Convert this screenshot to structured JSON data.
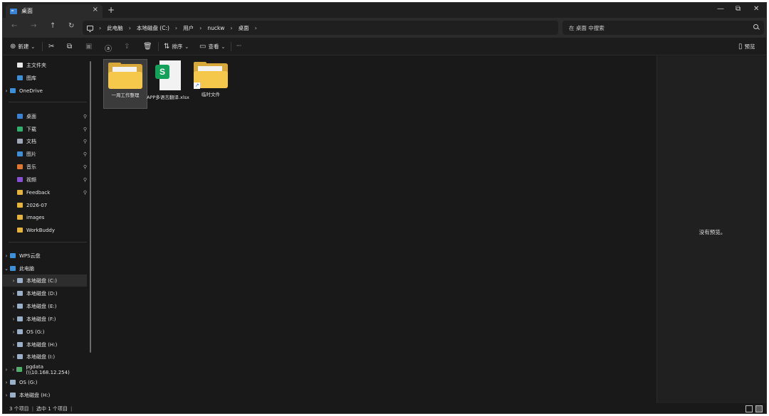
{
  "window": {
    "tab_title": "桌面",
    "tab_close": "×",
    "new_tab": "+",
    "minimize": "—",
    "maximize": "⧉",
    "close": "✕"
  },
  "nav": {
    "back": "←",
    "forward": "→",
    "up": "↑",
    "refresh": "↻",
    "breadcrumb": [
      "此电脑",
      "本地磁盘 (C:)",
      "用户",
      "nuckw",
      "桌面"
    ],
    "sep": "›",
    "search_placeholder": "在 桌面 中搜索"
  },
  "toolbar": {
    "new": "新建",
    "sort": "排序",
    "view": "查看",
    "more": "···",
    "preview": "预览"
  },
  "sidebar": {
    "items": [
      {
        "label": "主文件夹",
        "icon": "home-icon",
        "color": "#e8e8e8"
      },
      {
        "label": "图库",
        "icon": "gallery-icon",
        "color": "#3f8fd8"
      },
      {
        "label": "OneDrive",
        "icon": "cloud-icon",
        "color": "#3f8fd8"
      },
      {
        "label": "桌面",
        "icon": "desktop-icon",
        "color": "#3b82d6"
      },
      {
        "label": "下载",
        "icon": "download-icon",
        "color": "#30b06a"
      },
      {
        "label": "文档",
        "icon": "document-icon",
        "color": "#a0a8b8"
      },
      {
        "label": "图片",
        "icon": "pictures-icon",
        "color": "#3f8fd8"
      },
      {
        "label": "音乐",
        "icon": "music-icon",
        "color": "#e0782f"
      },
      {
        "label": "视频",
        "icon": "video-icon",
        "color": "#8a4fd8"
      },
      {
        "label": "Feedback",
        "icon": "folder-icon",
        "color": "#e6b43a"
      },
      {
        "label": "2026-07",
        "icon": "folder-icon",
        "color": "#e6b43a"
      },
      {
        "label": "images",
        "icon": "folder-icon",
        "color": "#e6b43a"
      },
      {
        "label": "WorkBuddy",
        "icon": "folder-icon",
        "color": "#e6b43a"
      },
      {
        "label": "WPS云盘",
        "icon": "cloud-icon",
        "color": "#3f8fd8"
      },
      {
        "label": "此电脑",
        "icon": "computer-icon",
        "color": "#3f8fd8"
      },
      {
        "label": "本地磁盘 (C:)",
        "icon": "drive-icon",
        "color": "#9ab0c8"
      },
      {
        "label": "本地磁盘 (D:)",
        "icon": "drive-icon",
        "color": "#9ab0c8"
      },
      {
        "label": "本地磁盘 (E:)",
        "icon": "drive-icon",
        "color": "#9ab0c8"
      },
      {
        "label": "本地磁盘 (F:)",
        "icon": "drive-icon",
        "color": "#9ab0c8"
      },
      {
        "label": "OS (G:)",
        "icon": "drive-icon",
        "color": "#9ab0c8"
      },
      {
        "label": "本地磁盘 (H:)",
        "icon": "drive-icon",
        "color": "#9ab0c8"
      },
      {
        "label": "本地磁盘 (I:)",
        "icon": "drive-icon",
        "color": "#9ab0c8"
      },
      {
        "label": "pgdata (\\\\10.168.12.254)",
        "icon": "network-drive-icon",
        "color": "#4caf6a"
      },
      {
        "label": "OS (G:)",
        "icon": "drive-icon",
        "color": "#9ab0c8"
      },
      {
        "label": "本地磁盘 (H:)",
        "icon": "drive-icon",
        "color": "#9ab0c8"
      }
    ],
    "pin": "📌"
  },
  "files": [
    {
      "name": "一周工作整理",
      "type": "folder"
    },
    {
      "name": "APP多语言翻译.xlsx",
      "type": "spreadsheet",
      "badge": "S"
    },
    {
      "name": "临时文件",
      "type": "folder-shortcut"
    }
  ],
  "preview": {
    "empty_text": "没有预览。"
  },
  "status": {
    "count": "3 个项目",
    "selected": "选中 1 个项目"
  }
}
